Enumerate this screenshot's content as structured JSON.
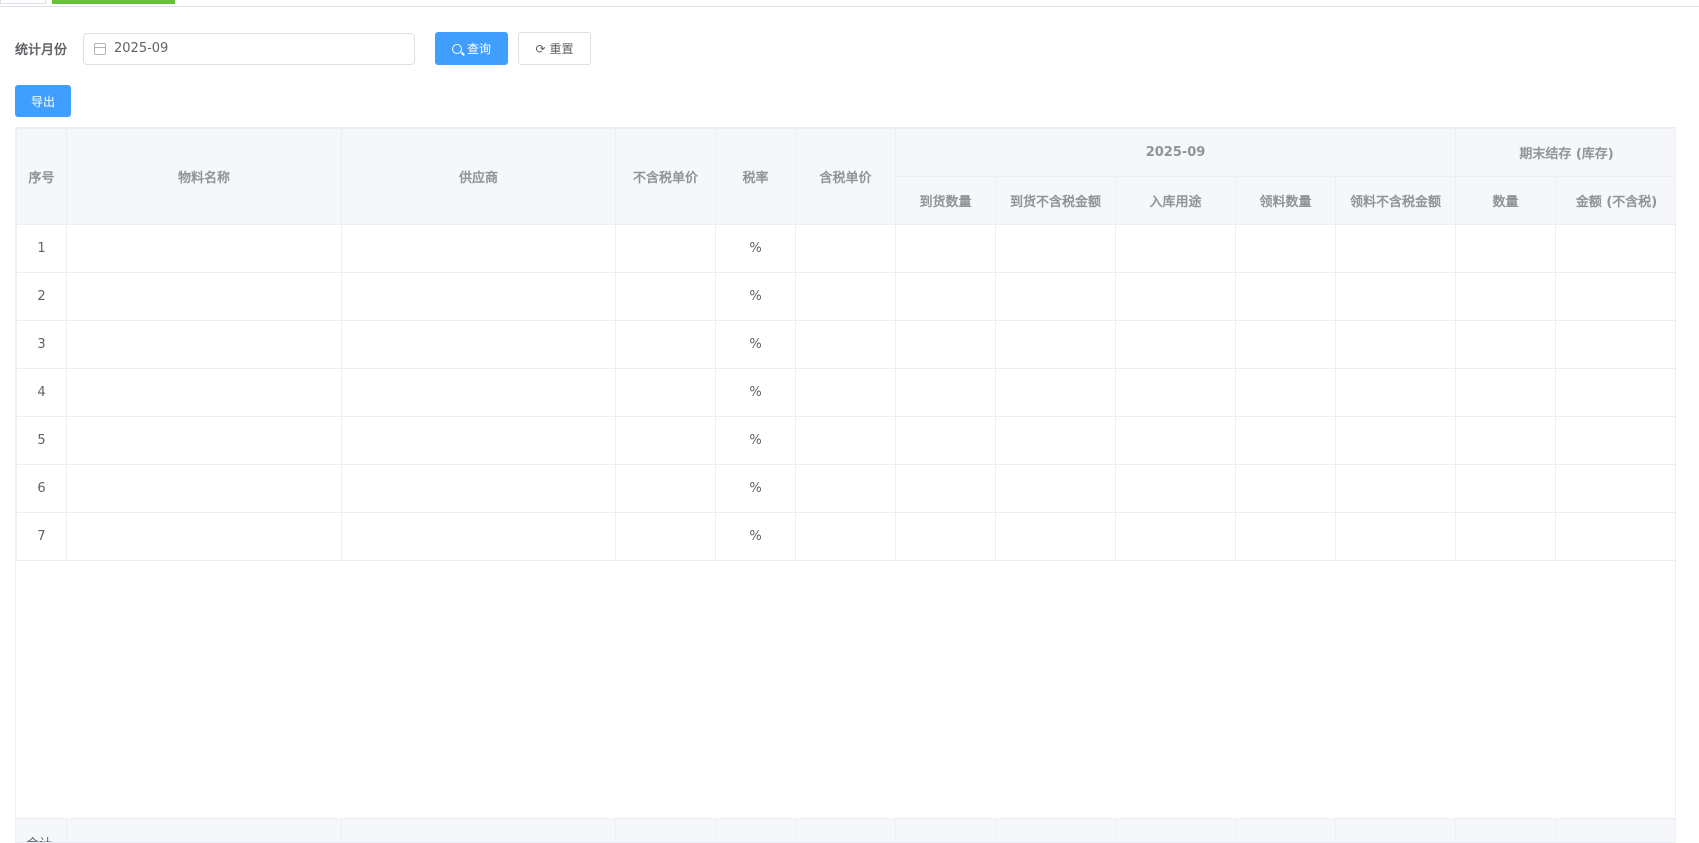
{
  "search": {
    "month_label": "统计月份",
    "month_value": "2025-09",
    "query_label": "查询",
    "reset_label": "重置"
  },
  "toolbar": {
    "export_label": "导出"
  },
  "table": {
    "headers": {
      "index": "序号",
      "material": "物料名称",
      "supplier": "供应商",
      "price_ex_tax": "不含税单价",
      "tax_rate": "税率",
      "price_inc_tax": "含税单价",
      "period_group": "2025-09",
      "ending_group": "期末结存 (库存)",
      "arrival_qty": "到货数量",
      "arrival_amount": "到货不含税金额",
      "inbound_use": "入库用途",
      "issue_qty": "领料数量",
      "issue_amount": "领料不含税金额",
      "ending_qty": "数量",
      "ending_amount": "金额 (不含税)"
    },
    "rows": [
      {
        "index": "1",
        "tax": "%"
      },
      {
        "index": "2",
        "tax": "%"
      },
      {
        "index": "3",
        "tax": "%"
      },
      {
        "index": "4",
        "tax": "%"
      },
      {
        "index": "5",
        "tax": "%"
      },
      {
        "index": "6",
        "tax": "%"
      },
      {
        "index": "7",
        "tax": "%"
      }
    ],
    "footer_label": "合计"
  }
}
